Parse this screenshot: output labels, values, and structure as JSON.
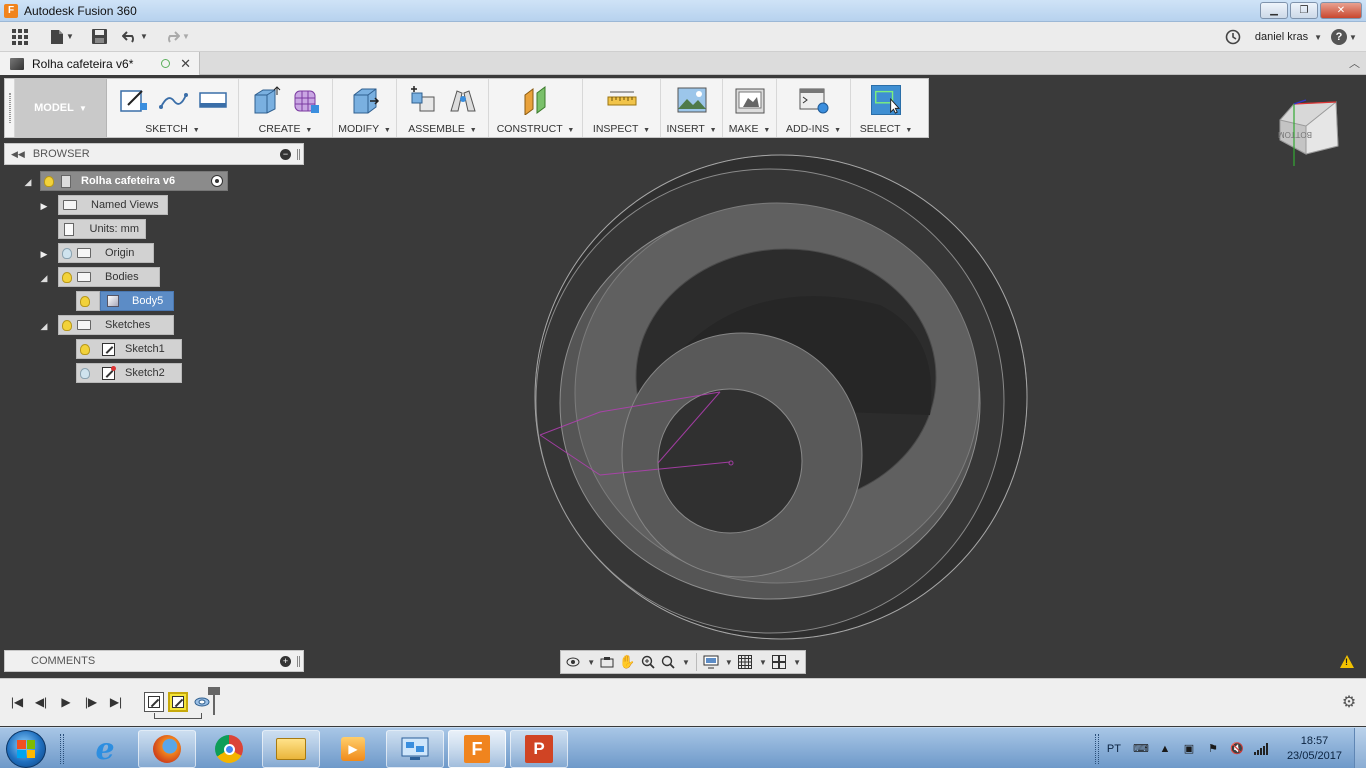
{
  "window": {
    "title": "Autodesk Fusion 360",
    "app_icon_letter": "F",
    "controls": [
      "minimize",
      "maximize",
      "close"
    ]
  },
  "quick_access": {
    "icons": [
      "data-panel-icon",
      "file-icon",
      "save-icon",
      "undo-icon",
      "redo-icon"
    ],
    "user_name": "daniel kras",
    "help_icon": "?"
  },
  "document_tab": {
    "title": "Rolha cafeteira v6*",
    "close": "✕"
  },
  "ribbon": {
    "workspace": "MODEL",
    "groups": [
      {
        "label": "SKETCH"
      },
      {
        "label": "CREATE"
      },
      {
        "label": "MODIFY"
      },
      {
        "label": "ASSEMBLE"
      },
      {
        "label": "CONSTRUCT"
      },
      {
        "label": "INSPECT"
      },
      {
        "label": "INSERT"
      },
      {
        "label": "MAKE"
      },
      {
        "label": "ADD-INS"
      },
      {
        "label": "SELECT"
      }
    ]
  },
  "browser": {
    "header": "BROWSER",
    "root": "Rolha cafeteira v6",
    "nodes": [
      {
        "label": "Named Views"
      },
      {
        "label": "Units: mm"
      },
      {
        "label": "Origin"
      },
      {
        "label": "Bodies"
      },
      {
        "label": "Body5"
      },
      {
        "label": "Sketches"
      },
      {
        "label": "Sketch1"
      },
      {
        "label": "Sketch2"
      }
    ]
  },
  "viewcube": {
    "face_label": "BOTTOM"
  },
  "comments": {
    "header": "COMMENTS"
  },
  "navbar": {
    "icons": [
      "orbit-icon",
      "look-at-icon",
      "pan-icon",
      "zoom-icon",
      "fit-icon",
      "display-settings-icon",
      "grid-icon",
      "viewports-icon"
    ]
  },
  "timeline": {
    "controls": [
      "first",
      "previous",
      "play",
      "next",
      "last"
    ],
    "features": [
      "Sketch1",
      "Sketch2",
      "Body5"
    ]
  },
  "taskbar": {
    "apps": [
      "Internet Explorer",
      "Firefox",
      "Chrome",
      "Explorer",
      "Media Player",
      "Network",
      "Fusion 360",
      "PowerPoint"
    ],
    "fusion_badge": "F",
    "ppt_badge": "P",
    "language": "PT",
    "time": "18:57",
    "date": "23/05/2017"
  },
  "colors": {
    "viewport_bg": "#3a3a3a",
    "selection_blue": "#5c8cc6",
    "sketch_magenta": "#c040c0",
    "fusion_orange": "#f0841e",
    "ppt_red": "#d04424"
  }
}
